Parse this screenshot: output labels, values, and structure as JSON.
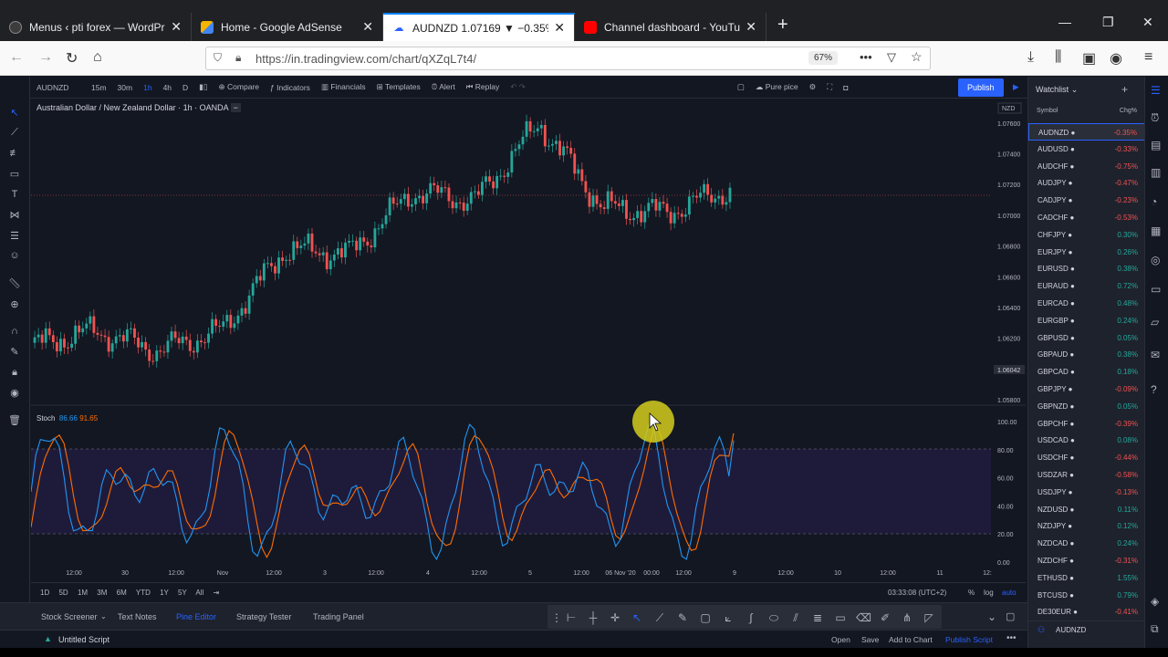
{
  "browser": {
    "tabs": [
      {
        "title": "Menus ‹ pti forex — WordPress",
        "favicon": "wordpress-icon",
        "color": "#3c3c3c"
      },
      {
        "title": "Home - Google AdSense",
        "favicon": "adsense-icon",
        "color": "#f4b400"
      },
      {
        "title": "AUDNZD 1.07169 ▼ −0.35% Pu",
        "favicon": "tradingview-icon",
        "color": "#2962ff"
      },
      {
        "title": "Channel dashboard - YouTube",
        "favicon": "youtube-icon",
        "color": "#ff0000"
      }
    ],
    "url": "https://in.tradingview.com/chart/qXZqL7t4/",
    "zoom": "67%"
  },
  "toolbar": {
    "symbol": "AUDNZD",
    "intervals": [
      "15m",
      "30m",
      "1h",
      "4h",
      "D"
    ],
    "selected_interval": "1h",
    "compare": "Compare",
    "indicators": "Indicators",
    "financials": "Financials",
    "templates": "Templates",
    "alert": "Alert",
    "replay": "Replay",
    "pure_price": "Pure pice",
    "publish": "Publish",
    "notifications": "11"
  },
  "chart": {
    "title": "Australian Dollar / New Zealand Dollar · 1h · OANDA",
    "currency": "NZD",
    "last_price_label": "1.06042",
    "stoch_label": "Stoch",
    "stoch_k": "86.66",
    "stoch_d": "91.65",
    "price_ticks": [
      "1.07600",
      "1.07400",
      "1.07200",
      "1.07000",
      "1.06800",
      "1.06600",
      "1.06400",
      "1.06200",
      "1.06000",
      "1.05800"
    ],
    "stoch_ticks": [
      "100.00",
      "80.00",
      "60.00",
      "40.00",
      "20.00",
      "0.00"
    ],
    "time_ticks": [
      "12:00",
      "30",
      "12:00",
      "Nov",
      "12:00",
      "3",
      "12:00",
      "4",
      "12:00",
      "5",
      "12:00",
      "06 Nov '20",
      "00:00",
      "12:00",
      "9",
      "12:00",
      "10",
      "12:00",
      "11",
      "12:"
    ],
    "colors": {
      "up": "#26a69a",
      "down": "#ef5350",
      "k_line": "#2196f3",
      "d_line": "#ff6d00",
      "band": "#1e1b3a"
    }
  },
  "chart_data": {
    "type": "candlestick",
    "symbol": "AUDNZD",
    "interval": "1h",
    "ylim": [
      1.058,
      1.077
    ],
    "key_points": [
      {
        "x": "Oct 29 12:00",
        "y": 1.0615
      },
      {
        "x": "30",
        "y": 1.0625
      },
      {
        "x": "Nov",
        "y": 1.0612
      },
      {
        "x": "3",
        "y": 1.0625
      },
      {
        "x": "3 12:00",
        "y": 1.0678
      },
      {
        "x": "4",
        "y": 1.0675
      },
      {
        "x": "4 12:00",
        "y": 1.0715
      },
      {
        "x": "5",
        "y": 1.071
      },
      {
        "x": "06 Nov '20",
        "y": 1.076
      },
      {
        "x": "00:00",
        "y": 1.0705
      },
      {
        "x": "12:00",
        "y": 1.0702
      },
      {
        "x": "9",
        "y": 1.0717
      }
    ],
    "stoch": {
      "k": 86.66,
      "d": 91.65,
      "upper": 80,
      "lower": 20
    }
  },
  "bottom": {
    "ranges": [
      "1D",
      "5D",
      "1M",
      "3M",
      "6M",
      "YTD",
      "1Y",
      "5Y",
      "All"
    ],
    "clock": "03:33:08 (UTC+2)",
    "pct": "%",
    "log": "log",
    "auto": "auto",
    "tabs": [
      "Stock Screener",
      "Text Notes",
      "Pine Editor",
      "Strategy Tester",
      "Trading Panel"
    ],
    "active_tab": "Pine Editor",
    "script_name": "Untitled Script",
    "actions": [
      "Open",
      "Save",
      "Add to Chart",
      "Publish Script"
    ]
  },
  "watchlist": {
    "title": "Watchlist",
    "col_symbol": "Symbol",
    "col_change": "Chg%",
    "items": [
      {
        "s": "AUDNZD",
        "c": "-0.35%"
      },
      {
        "s": "AUDUSD",
        "c": "-0.33%"
      },
      {
        "s": "AUDCHF",
        "c": "-0.75%"
      },
      {
        "s": "AUDJPY",
        "c": "-0.47%"
      },
      {
        "s": "CADJPY",
        "c": "-0.23%"
      },
      {
        "s": "CADCHF",
        "c": "-0.53%"
      },
      {
        "s": "CHFJPY",
        "c": "0.30%"
      },
      {
        "s": "EURJPY",
        "c": "0.26%"
      },
      {
        "s": "EURUSD",
        "c": "0.38%"
      },
      {
        "s": "EURAUD",
        "c": "0.72%"
      },
      {
        "s": "EURCAD",
        "c": "0.48%"
      },
      {
        "s": "EURGBP",
        "c": "0.24%"
      },
      {
        "s": "GBPUSD",
        "c": "0.05%"
      },
      {
        "s": "GBPAUD",
        "c": "0.38%"
      },
      {
        "s": "GBPCAD",
        "c": "0.18%"
      },
      {
        "s": "GBPJPY",
        "c": "-0.09%"
      },
      {
        "s": "GBPNZD",
        "c": "0.05%"
      },
      {
        "s": "GBPCHF",
        "c": "-0.39%"
      },
      {
        "s": "USDCAD",
        "c": "0.08%"
      },
      {
        "s": "USDCHF",
        "c": "-0.44%"
      },
      {
        "s": "USDZAR",
        "c": "-0.58%"
      },
      {
        "s": "USDJPY",
        "c": "-0.13%"
      },
      {
        "s": "NZDUSD",
        "c": "0.11%"
      },
      {
        "s": "NZDJPY",
        "c": "0.12%"
      },
      {
        "s": "NZDCAD",
        "c": "0.24%"
      },
      {
        "s": "NZDCHF",
        "c": "-0.31%"
      },
      {
        "s": "ETHUSD",
        "c": "1.55%"
      },
      {
        "s": "BTCUSD",
        "c": "0.79%"
      },
      {
        "s": "DE30EUR",
        "c": "-0.41%"
      }
    ],
    "footer_symbol": "AUDNZD"
  }
}
